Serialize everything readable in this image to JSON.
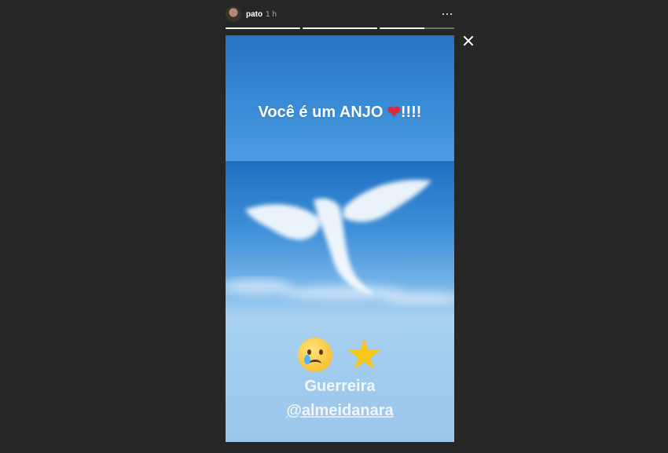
{
  "header": {
    "username": "pato",
    "timestamp": "1 h",
    "more_icon": "more-horizontal-icon"
  },
  "progress": {
    "segments": [
      1.0,
      1.0,
      0.6
    ]
  },
  "close_icon": "close-icon",
  "story": {
    "headline_prefix": "Você é um ANJO ",
    "headline_heart": "❤",
    "headline_suffix": "!!!!",
    "caption_line1": "Guerreira",
    "caption_line2": "@almeidanara",
    "emojis": [
      "crying-face-icon",
      "glowing-star-icon"
    ]
  },
  "colors": {
    "background": "#262626",
    "sky_blue": "#2f7fce",
    "heart": "#e0263a"
  }
}
